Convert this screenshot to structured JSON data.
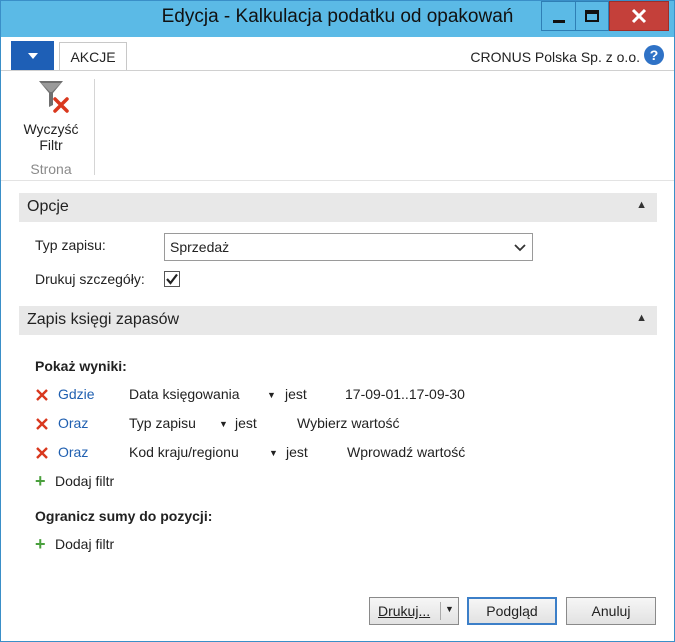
{
  "window": {
    "title": "Edycja - Kalkulacja podatku od opakowań",
    "accent": "#5bbae6",
    "close_color": "#c4403a"
  },
  "ribbon": {
    "tab_label": "AKCJE",
    "company": "CRONUS Polska Sp. z o.o.",
    "help": "?",
    "clear_filter_label_1": "Wyczyść",
    "clear_filter_label_2": "Filtr",
    "group_label": "Strona"
  },
  "options": {
    "header": "Opcje",
    "typ_zapisu_label": "Typ zapisu:",
    "typ_zapisu_value": "Sprzedaż",
    "print_details_label": "Drukuj szczegóły:",
    "print_details_checked": true
  },
  "filters": {
    "header": "Zapis księgi zapasów",
    "show_results_label": "Pokaż wyniki:",
    "rows": [
      {
        "connector": "Gdzie",
        "field": "Data księgowania",
        "op": "jest",
        "value": "17-09-01..17-09-30"
      },
      {
        "connector": "Oraz",
        "field": "Typ zapisu",
        "op": "jest",
        "value": "Wybierz wartość"
      },
      {
        "connector": "Oraz",
        "field": "Kod kraju/regionu",
        "op": "jest",
        "value": "Wprowadź wartość"
      }
    ],
    "add_filter_label": "Dodaj filtr",
    "limit_totals_label": "Ogranicz sumy do pozycji:",
    "add_filter_label_2": "Dodaj filtr"
  },
  "footer": {
    "print_label": "Drukuj...",
    "preview_label": "Podgląd",
    "cancel_label": "Anuluj"
  }
}
